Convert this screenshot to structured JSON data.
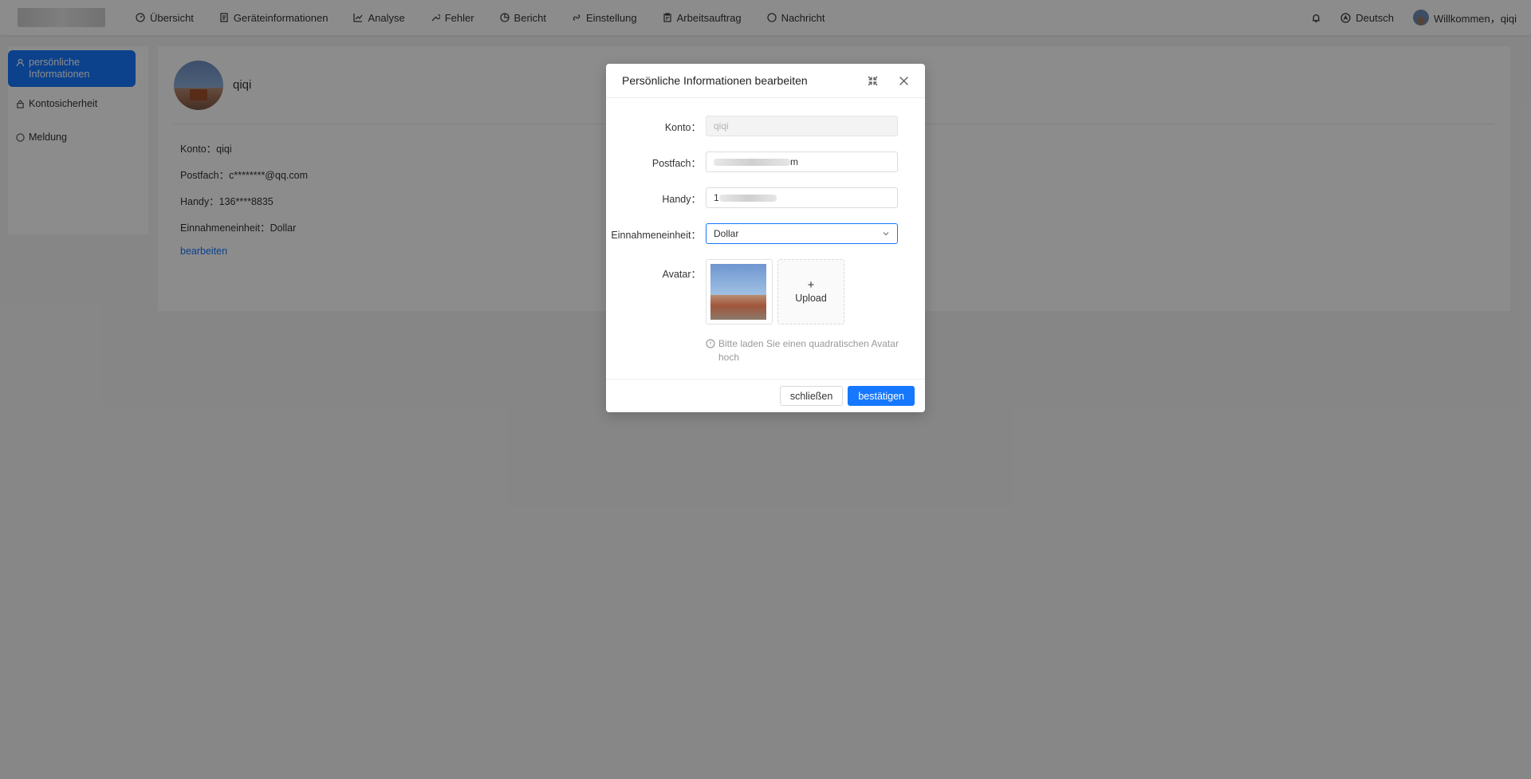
{
  "nav": {
    "items": [
      {
        "label": "Übersicht",
        "icon": "dashboard-icon"
      },
      {
        "label": "Geräteinformationen",
        "icon": "document-icon"
      },
      {
        "label": "Analyse",
        "icon": "chart-line-icon"
      },
      {
        "label": "Fehler",
        "icon": "wrench-icon"
      },
      {
        "label": "Bericht",
        "icon": "pie-chart-icon"
      },
      {
        "label": "Einstellung",
        "icon": "link-icon"
      },
      {
        "label": "Arbeitsauftrag",
        "icon": "clipboard-icon"
      },
      {
        "label": "Nachricht",
        "icon": "message-icon"
      }
    ],
    "language": "Deutsch",
    "welcome": "Willkommen，qiqi"
  },
  "sidebar": {
    "items": [
      {
        "label": "persönliche Informationen",
        "icon": "user-icon"
      },
      {
        "label": "Kontosicherheit",
        "icon": "lock-icon"
      },
      {
        "label": "Meldung",
        "icon": "message-icon"
      }
    ]
  },
  "profile": {
    "name": "qiqi",
    "rows": [
      {
        "label": "Konto：",
        "value": "qiqi"
      },
      {
        "label": "Postfach：",
        "value": "c********@qq.com"
      },
      {
        "label": "Handy：",
        "value": "136****8835"
      },
      {
        "label": "Einnahmeneinheit：",
        "value": "Dollar"
      }
    ],
    "edit_label": "bearbeiten"
  },
  "modal": {
    "title": "Persönliche Informationen bearbeiten",
    "fields": {
      "account_label": "Konto：",
      "account_value": "qiqi",
      "mailbox_label": "Postfach：",
      "mailbox_suffix": "m",
      "phone_label": "Handy：",
      "phone_prefix": "1",
      "unit_label": "Einnahmeneinheit：",
      "unit_value": "Dollar",
      "avatar_label": "Avatar："
    },
    "upload_plus": "+",
    "upload_label": "Upload",
    "hint": "Bitte laden Sie einen quadratischen Avatar hoch",
    "close_label": "schließen",
    "confirm_label": "bestätigen"
  },
  "colors": {
    "accent": "#1677ff",
    "overlay": "rgba(0,0,0,0.45)"
  }
}
